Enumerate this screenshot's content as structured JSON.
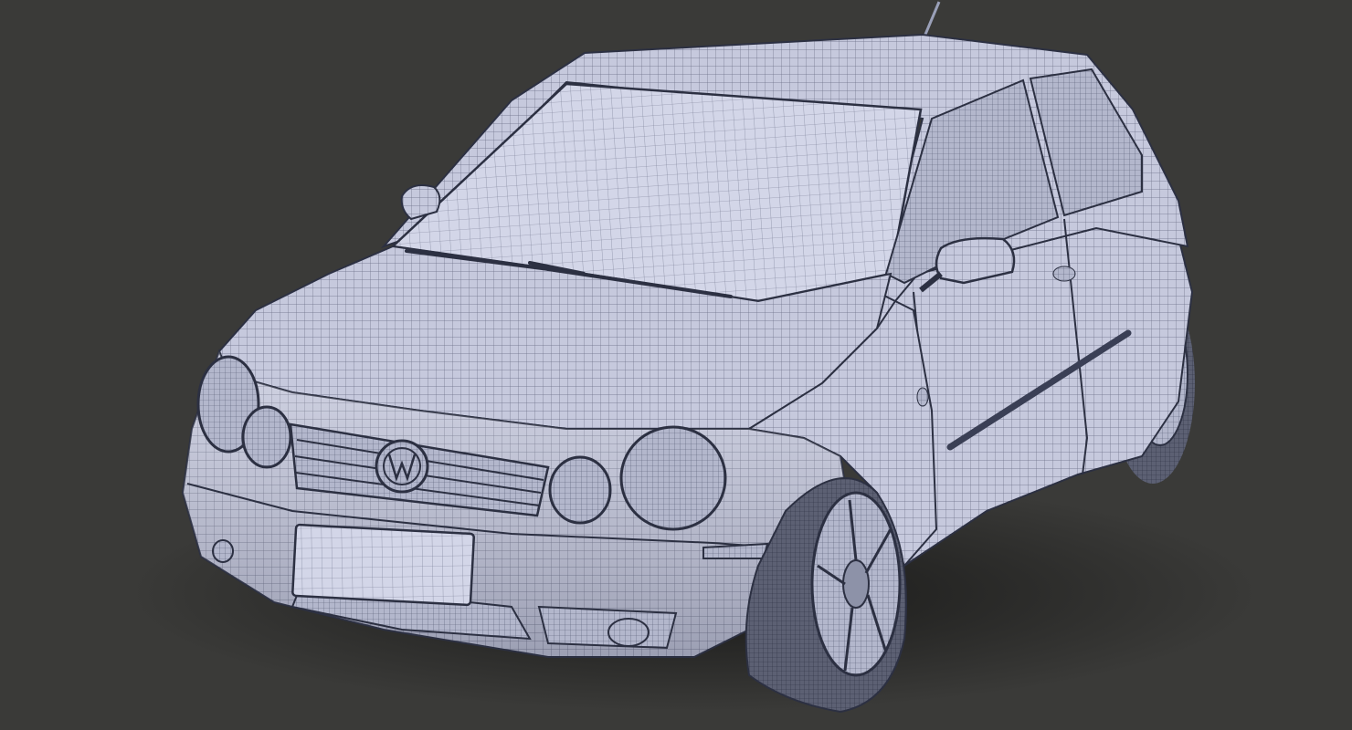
{
  "scene": {
    "subject": "hatchback-car-wireframe",
    "badge": "VW",
    "colors": {
      "background": "#3a3a38",
      "body_fill": "#c6c9dd",
      "body_highlight": "#d9dcec",
      "wire": "#4a5068",
      "shadow": "#1e1e1d",
      "tire": "#5c6073"
    }
  }
}
